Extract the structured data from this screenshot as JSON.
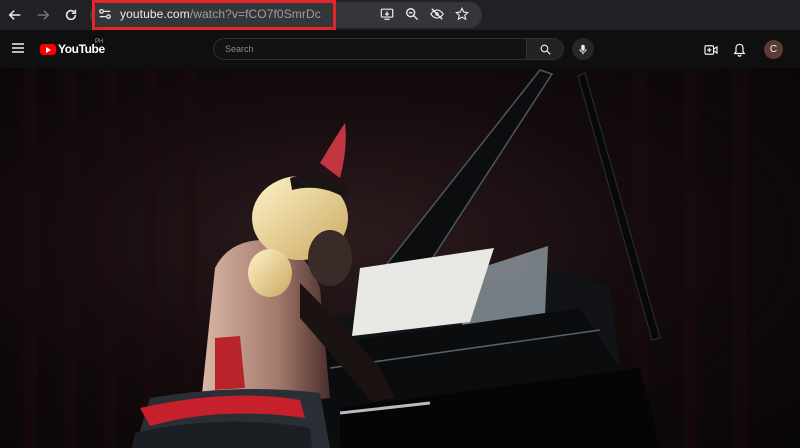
{
  "browser": {
    "url_domain": "youtube.com",
    "url_path": "/watch?v=fCO7f0SmrDc",
    "highlight_color": "#e3262b"
  },
  "youtube": {
    "logo_text": "YouTube",
    "region": "PH",
    "search_placeholder": "Search",
    "avatar_initial": "C",
    "brand_color": "#ff0000"
  },
  "video": {
    "description_icon": "video-frame"
  }
}
